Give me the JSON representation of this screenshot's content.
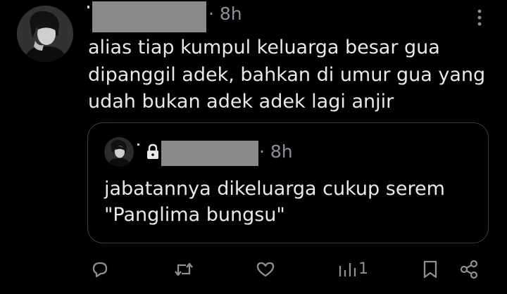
{
  "post": {
    "time": "· 8h",
    "text": "alias tiap kumpul keluarga besar gua\ndipanggil adek, bahkan di umur gua yang\nudah bukan adek adek lagi anjir"
  },
  "quote": {
    "time": "· 8h",
    "text": "jabatannya dikeluarga cukup serem\n\"Panglima bungsu\""
  },
  "actions": {
    "views_count": "1",
    "icons": [
      "reply-icon",
      "retweet-icon",
      "like-icon",
      "views-icon",
      "bookmark-icon",
      "share-icon"
    ]
  },
  "colors": {
    "background": "#000000",
    "text": "#e7e9ea",
    "muted": "#8b9096",
    "border": "#3a3f44",
    "redaction": "#8a8a8a"
  }
}
